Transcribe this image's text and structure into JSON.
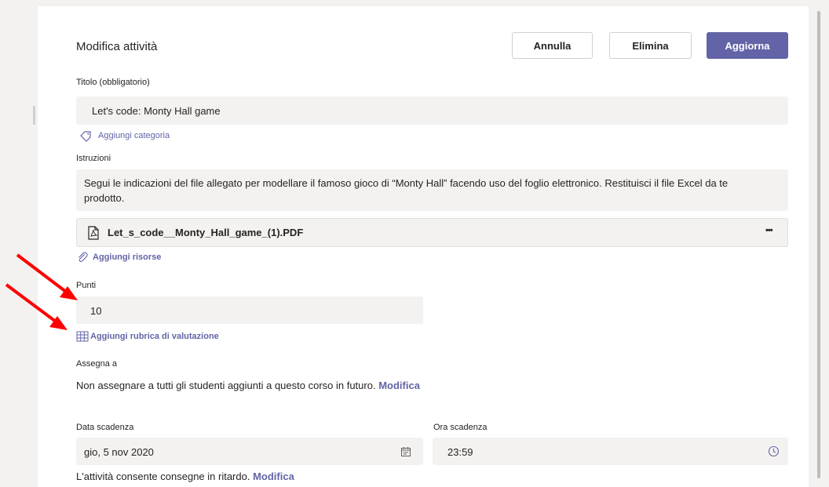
{
  "header": {
    "title": "Modifica attività",
    "cancel_label": "Annulla",
    "delete_label": "Elimina",
    "update_label": "Aggiorna"
  },
  "title_field": {
    "label": "Titolo (obbligatorio)",
    "value": "Let's code: Monty Hall game"
  },
  "add_category": {
    "label": "Aggiungi categoria",
    "icon": "tag-icon"
  },
  "instructions": {
    "label": "Istruzioni",
    "line1": "Segui le indicazioni del file allegato per modellare il famoso gioco di “Monty Hall” facendo uso del foglio elettronico. Restituisci il file Excel da te",
    "line2": "prodotto."
  },
  "attachment": {
    "name": "Let_s_code__Monty_Hall_game_(1).PDF",
    "icon": "pdf-file-icon",
    "more_label": "•••"
  },
  "add_resources": {
    "label": "Aggiungi risorse",
    "icon": "paperclip-icon"
  },
  "points": {
    "label": "Punti",
    "value": "10"
  },
  "add_rubric": {
    "label": "Aggiungi rubrica di valutazione",
    "icon": "grid-icon"
  },
  "assign": {
    "label": "Assegna a",
    "text": "Non assegnare a tutti gli studenti aggiunti a questo corso in futuro.",
    "link": "Modifica"
  },
  "due_date": {
    "label": "Data scadenza",
    "value": "gio, 5 nov 2020",
    "icon": "calendar-icon"
  },
  "due_time": {
    "label": "Ora scadenza",
    "value": "23:59",
    "icon": "clock-icon"
  },
  "late": {
    "text": "L'attività consente consegne in ritardo.",
    "link": "Modifica"
  },
  "colors": {
    "accent": "#6264a7",
    "field_bg": "#f3f2f1",
    "arrow": "#ff0000"
  }
}
